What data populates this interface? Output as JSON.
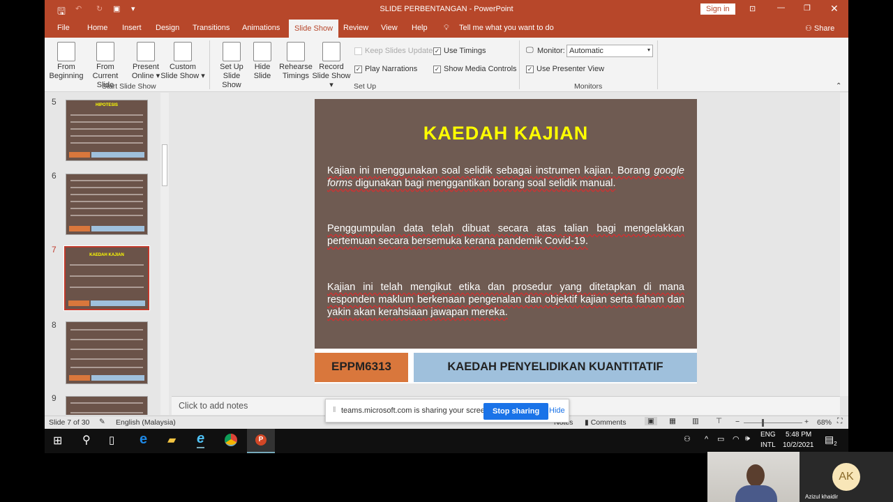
{
  "titlebar": {
    "title": "SLIDE PERBENTANGAN  -  PowerPoint",
    "sign_in": "Sign in"
  },
  "tabs": [
    "File",
    "Home",
    "Insert",
    "Design",
    "Transitions",
    "Animations",
    "Slide Show",
    "Review",
    "View",
    "Help"
  ],
  "tell_me": "Tell me what you want to do",
  "share": "Share",
  "ribbon": {
    "start": {
      "from_beginning": "From Beginning",
      "from_current": "From Current Slide",
      "present_online": "Present Online",
      "custom_show": "Custom Slide Show",
      "label": "Start Slide Show"
    },
    "setup": {
      "setup_show": "Set Up Slide Show",
      "hide_slide": "Hide Slide",
      "rehearse": "Rehearse Timings",
      "record": "Record Slide Show",
      "keep_updated": "Keep Slides Updated",
      "play_narrations": "Play Narrations",
      "use_timings": "Use Timings",
      "show_media": "Show Media Controls",
      "label": "Set Up"
    },
    "monitors": {
      "monitor_label": "Monitor:",
      "monitor_value": "Automatic",
      "presenter_view": "Use Presenter View",
      "label": "Monitors"
    }
  },
  "thumbnails": [
    {
      "num": "5",
      "title": "HIPOTESIS"
    },
    {
      "num": "6",
      "title": ""
    },
    {
      "num": "7",
      "title": "KAEDAH KAJIAN",
      "selected": true
    },
    {
      "num": "8",
      "title": ""
    },
    {
      "num": "9",
      "title": ""
    }
  ],
  "slide": {
    "title": "KAEDAH KAJIAN",
    "p1_a": "Kajian ini menggunakan soal selidik sebagai instrumen kajian. Borang ",
    "p1_i": "google forms",
    "p1_b": " digunakan bagi menggantikan borang soal selidik manual.",
    "p2": "Penggumpulan data telah dibuat secara atas talian bagi mengelakkan pertemuan secara bersemuka kerana pandemik Covid-19.",
    "p3": "Kajian ini telah mengikut etika dan prosedur yang ditetapkan di mana responden maklum berkenaan pengenalan dan objektif kajian serta faham dan yakin akan kerahsiaan jawapan mereka.",
    "footer_code": "EPPM6313",
    "footer_title": "KAEDAH PENYELIDIKAN KUANTITATIF"
  },
  "notes_placeholder": "Click to add notes",
  "status": {
    "slide": "Slide 7 of 30",
    "language": "English (Malaysia)",
    "notes": "Notes",
    "comments": "Comments",
    "zoom": "68%"
  },
  "sharing": {
    "text": "teams.microsoft.com is sharing your screen.",
    "stop": "Stop sharing",
    "hide": "Hide"
  },
  "taskbar": {
    "lang1": "ENG",
    "lang2": "INTL",
    "time": "5:48 PM",
    "date": "10/2/2021",
    "notif_count": "2"
  },
  "video": {
    "initials": "AK",
    "name": "Azizul khaidir"
  },
  "colors": {
    "accent": "#b7472a",
    "slide_bg": "#6f5b52",
    "title": "#ffff00",
    "footer_orange": "#d9773c",
    "footer_blue": "#9fc0dc",
    "stop_btn": "#1a73e8"
  }
}
